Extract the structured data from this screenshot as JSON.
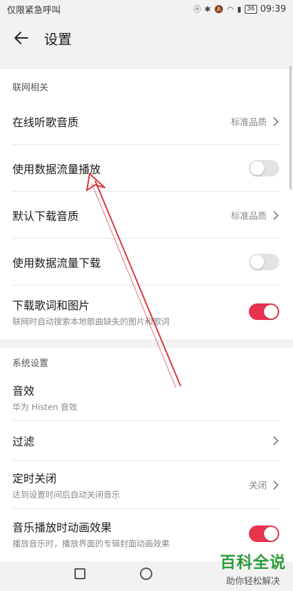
{
  "statusbar": {
    "carrier": "仅限紧急呼叫",
    "battery": "36",
    "time": "09:39"
  },
  "header": {
    "title": "设置"
  },
  "section1": {
    "label": "联网相关",
    "rows": [
      {
        "title": "在线听歌音质",
        "value": "标准品质"
      },
      {
        "title": "使用数据流量播放",
        "toggle": false
      },
      {
        "title": "默认下载音质",
        "value": "标准品质"
      },
      {
        "title": "使用数据流量下载",
        "toggle": false
      },
      {
        "title": "下载歌词和图片",
        "subtitle": "联网时自动搜索本地歌曲缺失的图片和歌词",
        "toggle": true
      }
    ]
  },
  "section2": {
    "label": "系统设置",
    "rows": [
      {
        "title": "音效",
        "subtitle": "华为 Histen 音效"
      },
      {
        "title": "过滤"
      },
      {
        "title": "定时关闭",
        "subtitle": "达到设置时间后自动关闭音乐",
        "value": "关闭"
      },
      {
        "title": "音乐播放时动画效果",
        "subtitle": "播放音乐时，播放界面的专辑封面动画效果",
        "toggle": true
      }
    ]
  },
  "watermark": {
    "big": "百科全说",
    "small": "助你轻松解决"
  },
  "colors": {
    "toggle_on": "#e8344e",
    "arrow": "#d9363e",
    "watermark": "#2a9d3a"
  }
}
